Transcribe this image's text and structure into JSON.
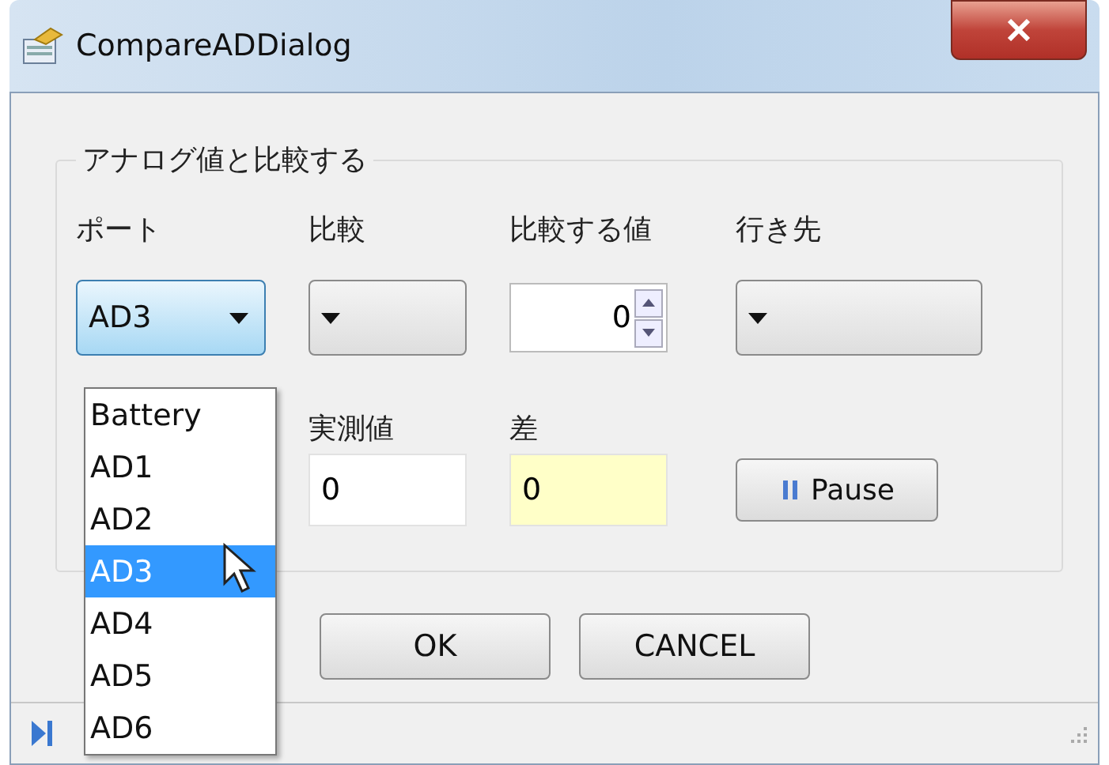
{
  "window": {
    "title": "CompareADDialog"
  },
  "group": {
    "title": "アナログ値と比較する",
    "labels": [
      "ポート",
      "比較",
      "比較する値",
      "行き先"
    ],
    "port": {
      "value": "AD3",
      "open": true,
      "items": [
        {
          "label": "Battery",
          "selected": false
        },
        {
          "label": "AD1",
          "selected": false
        },
        {
          "label": "AD2",
          "selected": false
        },
        {
          "label": "AD3",
          "selected": true
        },
        {
          "label": "AD4",
          "selected": false
        },
        {
          "label": "AD5",
          "selected": false
        },
        {
          "label": "AD6",
          "selected": false
        }
      ]
    },
    "compare_value": {
      "value": "0"
    },
    "measured": {
      "label": "実測値",
      "value": "0",
      "highlighted": false
    },
    "difference": {
      "label": "差",
      "value": "0",
      "highlighted": true
    },
    "pause_button": "Pause"
  },
  "buttons": [
    "OK",
    "CANCEL"
  ]
}
